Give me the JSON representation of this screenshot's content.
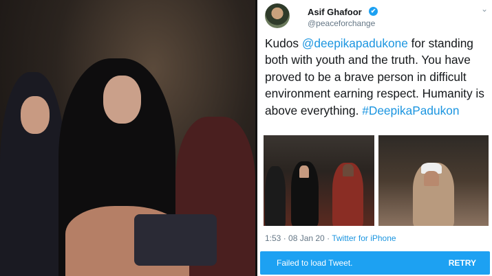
{
  "tweet": {
    "author_name": "Asif Ghafoor",
    "handle": "@peaceforchange",
    "text_prefix": "Kudos ",
    "mention": "@deepikapadukone",
    "text_main": " for standing both with youth and the truth. You have proved to be a brave person in difficult environment earning respect. Humanity is above everything. ",
    "hashtag": "#DeepikaPadukon",
    "time": "1:53 · 08 Jan 20 · ",
    "source": "Twitter for iPhone",
    "verified_icon": "✔",
    "chevron_icon": "⌄"
  },
  "error_bar": {
    "message": "Failed to load Tweet.",
    "retry_label": "RETRY"
  },
  "colors": {
    "link": "#1b95e0",
    "error_bg": "#1da1f2"
  }
}
